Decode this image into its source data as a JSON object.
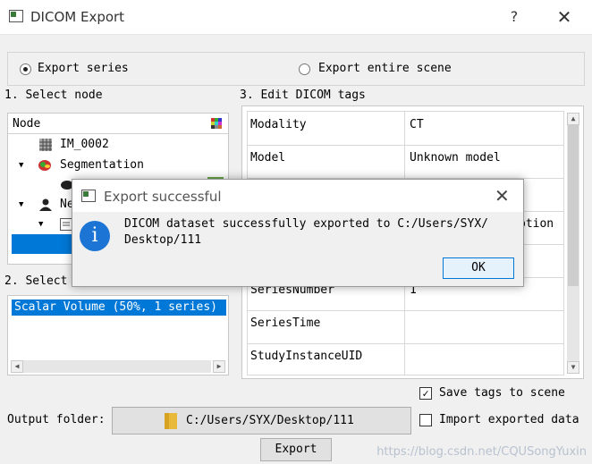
{
  "window": {
    "title": "DICOM Export",
    "help": "?",
    "close": "✕"
  },
  "export_mode": {
    "option_series": "Export series",
    "option_scene": "Export entire scene",
    "selected": "series"
  },
  "select_node": {
    "label": "1. Select node",
    "header": "Node",
    "items": [
      {
        "label": "IM_0002",
        "icon": "volume-icon"
      },
      {
        "label": "Segmentation",
        "icon": "segmentation-icon"
      },
      {
        "label": "Ne",
        "icon": "patient-icon"
      }
    ]
  },
  "export_type": {
    "label": "2. Select export type",
    "label_visible": "2. Select",
    "items": [
      "Scalar Volume (50%, 1 series)"
    ]
  },
  "dicom_tags": {
    "label": "3. Edit DICOM tags",
    "rows": [
      {
        "name": "Modality",
        "value": "CT"
      },
      {
        "name": "Model",
        "value": "Unknown model"
      },
      {
        "name": "",
        "value": ""
      },
      {
        "name": "",
        "value": "ption"
      },
      {
        "name": "",
        "value": ""
      },
      {
        "name": "SeriesNumber",
        "value": "1"
      },
      {
        "name": "SeriesTime",
        "value": ""
      },
      {
        "name": "StudyInstanceUID",
        "value": ""
      }
    ]
  },
  "options": {
    "save_tags": "Save tags to scene",
    "save_tags_checked": true,
    "import_exported": "Import exported data",
    "import_checked": false
  },
  "output": {
    "label": "Output folder:",
    "path": "C:/Users/SYX/Desktop/111"
  },
  "export_button": "Export",
  "message_box": {
    "title": "Export successful",
    "text_line1": "DICOM dataset successfully exported to C:/Users/SYX/",
    "text_line2": "Desktop/111",
    "ok": "OK",
    "icon": "info-icon"
  },
  "watermark": "https://blog.csdn.net/CQUSongYuxin"
}
